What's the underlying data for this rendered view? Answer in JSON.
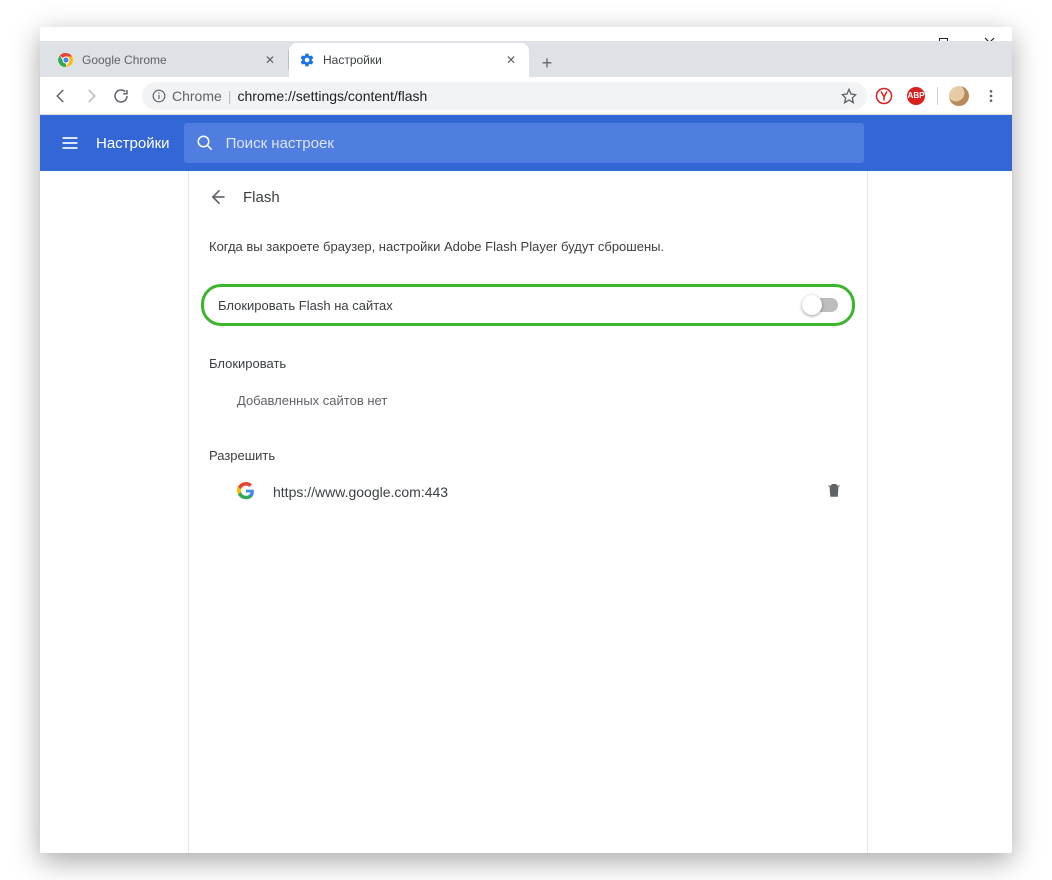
{
  "window": {
    "tabs": [
      {
        "label": "Google Chrome",
        "active": false
      },
      {
        "label": "Настройки",
        "active": true
      }
    ]
  },
  "toolbar": {
    "chrome_host_label": "Chrome",
    "url": "chrome://settings/content/flash"
  },
  "header": {
    "title": "Настройки",
    "search_placeholder": "Поиск настроек"
  },
  "panel": {
    "title": "Flash",
    "info": "Когда вы закроете браузер, настройки Adobe Flash Player будут сброшены.",
    "toggle_label": "Блокировать Flash на сайтах",
    "toggle_on": false,
    "block_section": "Блокировать",
    "block_empty": "Добавленных сайтов нет",
    "allow_section": "Разрешить",
    "allow_sites": [
      {
        "url": "https://www.google.com:443"
      }
    ]
  },
  "icons": {
    "abp": "ABP"
  }
}
